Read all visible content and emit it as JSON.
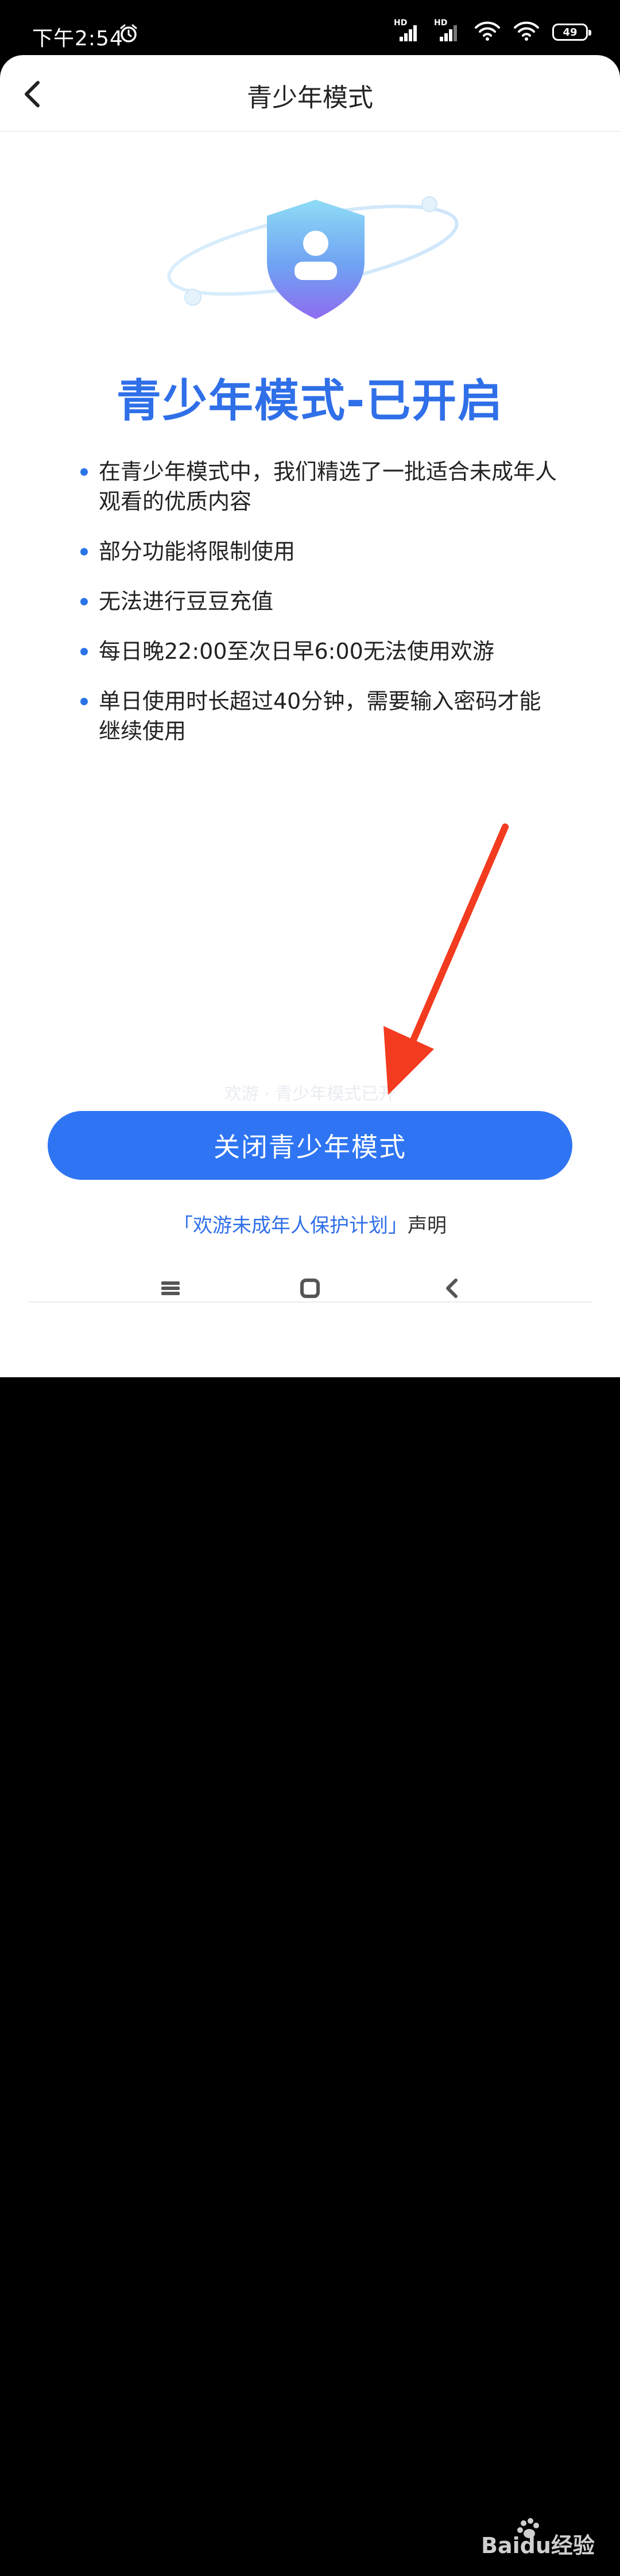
{
  "status_bar": {
    "time": "下午2:54",
    "hd_label": "HD",
    "battery": "49"
  },
  "header": {
    "title": "青少年模式"
  },
  "headline": "青少年模式-已开启",
  "bullets": [
    "在青少年模式中，我们精选了一批适合未成年人观看的优质内容",
    "部分功能将限制使用",
    "无法进行豆豆充值",
    "每日晚22:00至次日早6:00无法使用欢游",
    "单日使用时长超过40分钟，需要输入密码才能继续使用"
  ],
  "faded_text": "欢游 · 青少年模式已开",
  "primary_button": "关闭青少年模式",
  "footer": {
    "link_text": "「欢游未成年人保护计划」",
    "suffix": "声明"
  },
  "watermark": "Baidu经验",
  "colors": {
    "accent": "#2f75f3",
    "headline": "#2f6fe8",
    "arrow": "#f23b1f"
  }
}
